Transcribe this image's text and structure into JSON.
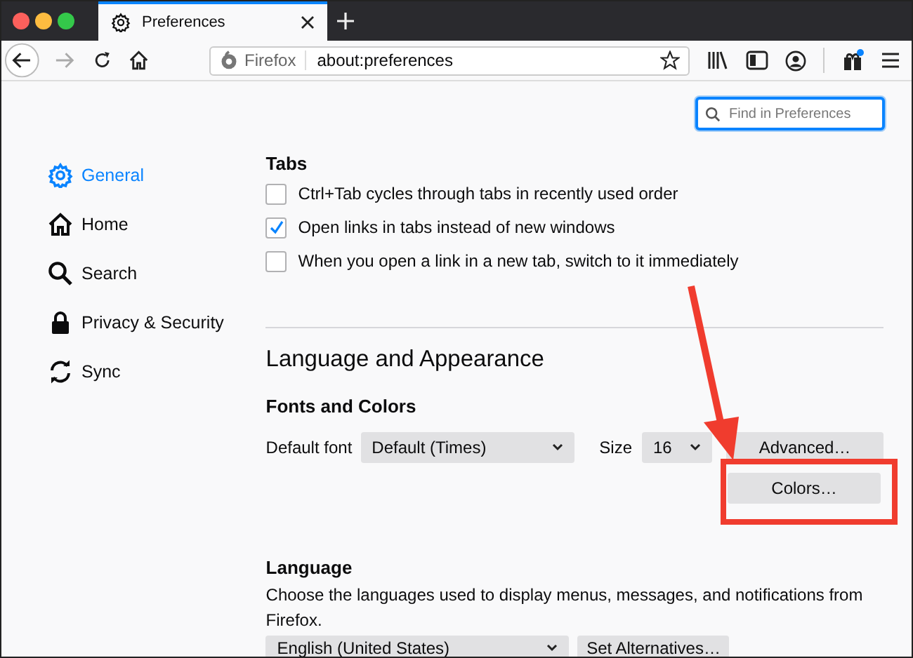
{
  "tab_bar": {
    "tab_title": "Preferences"
  },
  "toolbar": {
    "forward": {
      "disabled": true
    },
    "identity_label": "Firefox",
    "url": "about:preferences"
  },
  "search": {
    "placeholder": "Find in Preferences"
  },
  "sidebar": {
    "items": [
      {
        "kind": "gear",
        "label": "General",
        "selected": true
      },
      {
        "kind": "home",
        "label": "Home",
        "selected": false
      },
      {
        "kind": "search",
        "label": "Search",
        "selected": false
      },
      {
        "kind": "lock",
        "label": "Privacy & Security",
        "selected": false
      },
      {
        "kind": "sync",
        "label": "Sync",
        "selected": false
      }
    ]
  },
  "tabs_section": {
    "heading": "Tabs",
    "options": [
      {
        "label": "Ctrl+Tab cycles through tabs in recently used order",
        "checked": false
      },
      {
        "label": "Open links in tabs instead of new windows",
        "checked": true
      },
      {
        "label": "When you open a link in a new tab, switch to it immediately",
        "checked": false
      }
    ]
  },
  "language_and_appearance": {
    "heading": "Language and Appearance",
    "fonts_and_colors": {
      "heading": "Fonts and Colors",
      "default_font_label": "Default font",
      "default_font": "Default (Times)",
      "size_label": "Size",
      "size": "16",
      "advanced_button": "Advanced…",
      "colors_button": "Colors…"
    }
  },
  "language": {
    "heading": "Language",
    "description": "Choose the languages used to display menus, messages, and notifications from Firefox.",
    "language_select": "English (United States)",
    "alternatives_button": "Set Alternatives…"
  }
}
